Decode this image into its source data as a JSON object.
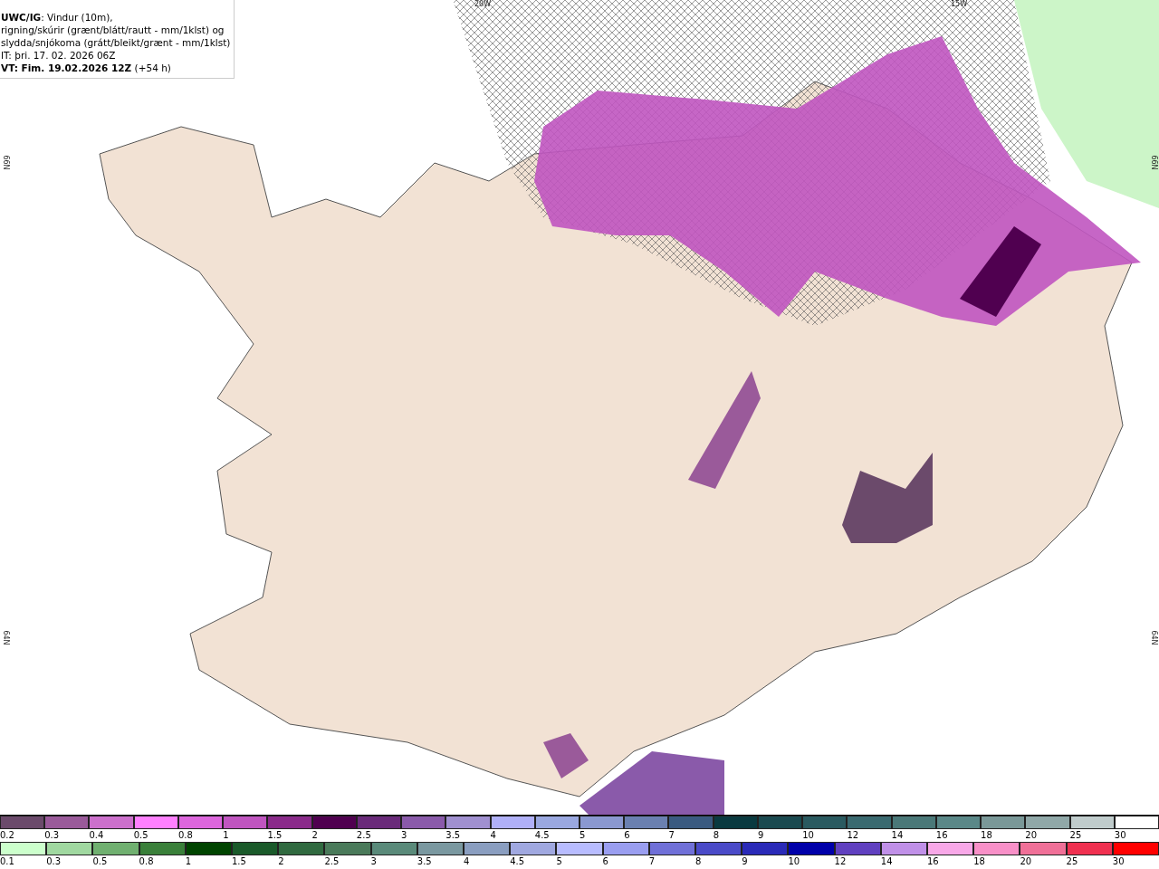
{
  "header": {
    "title": "UWC/IG",
    "lines": [
      ": Vindur (10m),",
      "rigning/skúrir (grænt/blátt/rautt - mm/1klst) og",
      "slydda/snjókoma (grátt/bleikt/grænt - mm/1klst)",
      "IT: þri. 17. 02. 2026 06Z"
    ],
    "valid_label": "VT: Fim. 19.02.2026 12Z",
    "valid_offset": "(+54 h)"
  },
  "grid_labels": {
    "top": [
      "20W",
      "15W"
    ],
    "left": [
      "66N",
      "64N"
    ],
    "right": [
      "66N",
      "64N"
    ]
  },
  "legends": [
    {
      "items": [
        {
          "label": "0.2",
          "color": "#6b4a6b"
        },
        {
          "label": "0.3",
          "color": "#9a5a9a"
        },
        {
          "label": "0.4",
          "color": "#cc70cc"
        },
        {
          "label": "0.5",
          "color": "#ff80ff"
        },
        {
          "label": "0.8",
          "color": "#dd66dd"
        },
        {
          "label": "1",
          "color": "#c055c0"
        },
        {
          "label": "1.5",
          "color": "#8a2a8a"
        },
        {
          "label": "2",
          "color": "#500050"
        },
        {
          "label": "2.5",
          "color": "#6a2a7a"
        },
        {
          "label": "3",
          "color": "#8a5aaa"
        },
        {
          "label": "3.5",
          "color": "#a090d0"
        },
        {
          "label": "4",
          "color": "#b0b0f8"
        },
        {
          "label": "4.5",
          "color": "#9aa8e0"
        },
        {
          "label": "5",
          "color": "#8a98d0"
        },
        {
          "label": "6",
          "color": "#6a80b0"
        },
        {
          "label": "7",
          "color": "#3a5a80"
        },
        {
          "label": "8",
          "color": "#0a3a40"
        },
        {
          "label": "9",
          "color": "#1a4a50"
        },
        {
          "label": "10",
          "color": "#2a5a60"
        },
        {
          "label": "12",
          "color": "#3a6a70"
        },
        {
          "label": "14",
          "color": "#4a7878"
        },
        {
          "label": "16",
          "color": "#5a8888"
        },
        {
          "label": "18",
          "color": "#7a9898"
        },
        {
          "label": "20",
          "color": "#90a8a8"
        },
        {
          "label": "25",
          "color": "#c0cccc"
        },
        {
          "label": "30",
          "color": "#ffffff"
        }
      ]
    },
    {
      "items": [
        {
          "label": "0.1",
          "color": "#ccffcc"
        },
        {
          "label": "0.3",
          "color": "#a0d8a0"
        },
        {
          "label": "0.5",
          "color": "#70b070"
        },
        {
          "label": "0.8",
          "color": "#3a803a"
        },
        {
          "label": "1",
          "color": "#004400"
        },
        {
          "label": "1.5",
          "color": "#1a5a2a"
        },
        {
          "label": "2",
          "color": "#306a40"
        },
        {
          "label": "2.5",
          "color": "#4a7a5a"
        },
        {
          "label": "3",
          "color": "#5a8a7a"
        },
        {
          "label": "3.5",
          "color": "#7a98a0"
        },
        {
          "label": "4",
          "color": "#8a9ec0"
        },
        {
          "label": "4.5",
          "color": "#a0a8e0"
        },
        {
          "label": "5",
          "color": "#b8bcff"
        },
        {
          "label": "6",
          "color": "#9a9ef0"
        },
        {
          "label": "7",
          "color": "#7070d8"
        },
        {
          "label": "8",
          "color": "#4a4ac8"
        },
        {
          "label": "9",
          "color": "#2a2ab8"
        },
        {
          "label": "10",
          "color": "#0000aa"
        },
        {
          "label": "12",
          "color": "#6040c0"
        },
        {
          "label": "14",
          "color": "#c090e8"
        },
        {
          "label": "16",
          "color": "#f8a8e8"
        },
        {
          "label": "18",
          "color": "#f890c8"
        },
        {
          "label": "20",
          "color": "#f07098"
        },
        {
          "label": "25",
          "color": "#f03050"
        },
        {
          "label": "30",
          "color": "#ff0000"
        }
      ]
    }
  ]
}
